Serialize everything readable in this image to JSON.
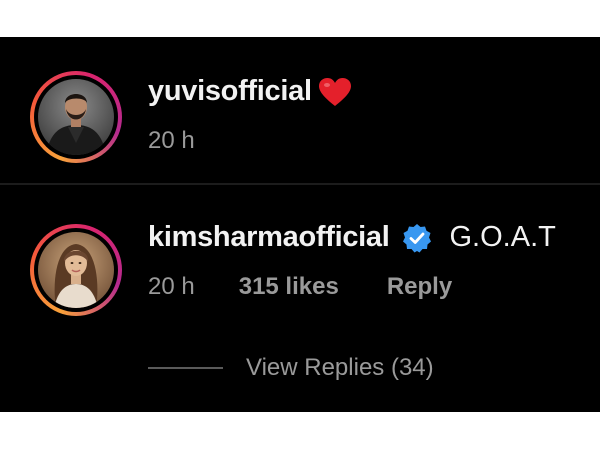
{
  "comments": [
    {
      "username": "yuvisofficial",
      "text": "",
      "time": "20 h",
      "avatar_icon": "person-photo-avatar",
      "trailing_icon": "heart-icon",
      "heart_color": "#e4202b"
    },
    {
      "username": "kimsharmaofficial",
      "text": "G.O.A.T",
      "time": "20 h",
      "likes": "315 likes",
      "reply": "Reply",
      "avatar_icon": "person-photo-avatar",
      "verified_icon": "verified-badge-icon",
      "verified_color": "#3897f0",
      "view_replies": "View Replies (34)"
    }
  ],
  "colors": {
    "background": "#000000",
    "text_primary": "#f2f2f2",
    "text_secondary": "#9a9a9a",
    "story_ring": [
      "#f9a13a",
      "#f4593a",
      "#d9246e",
      "#b52a8f"
    ]
  }
}
